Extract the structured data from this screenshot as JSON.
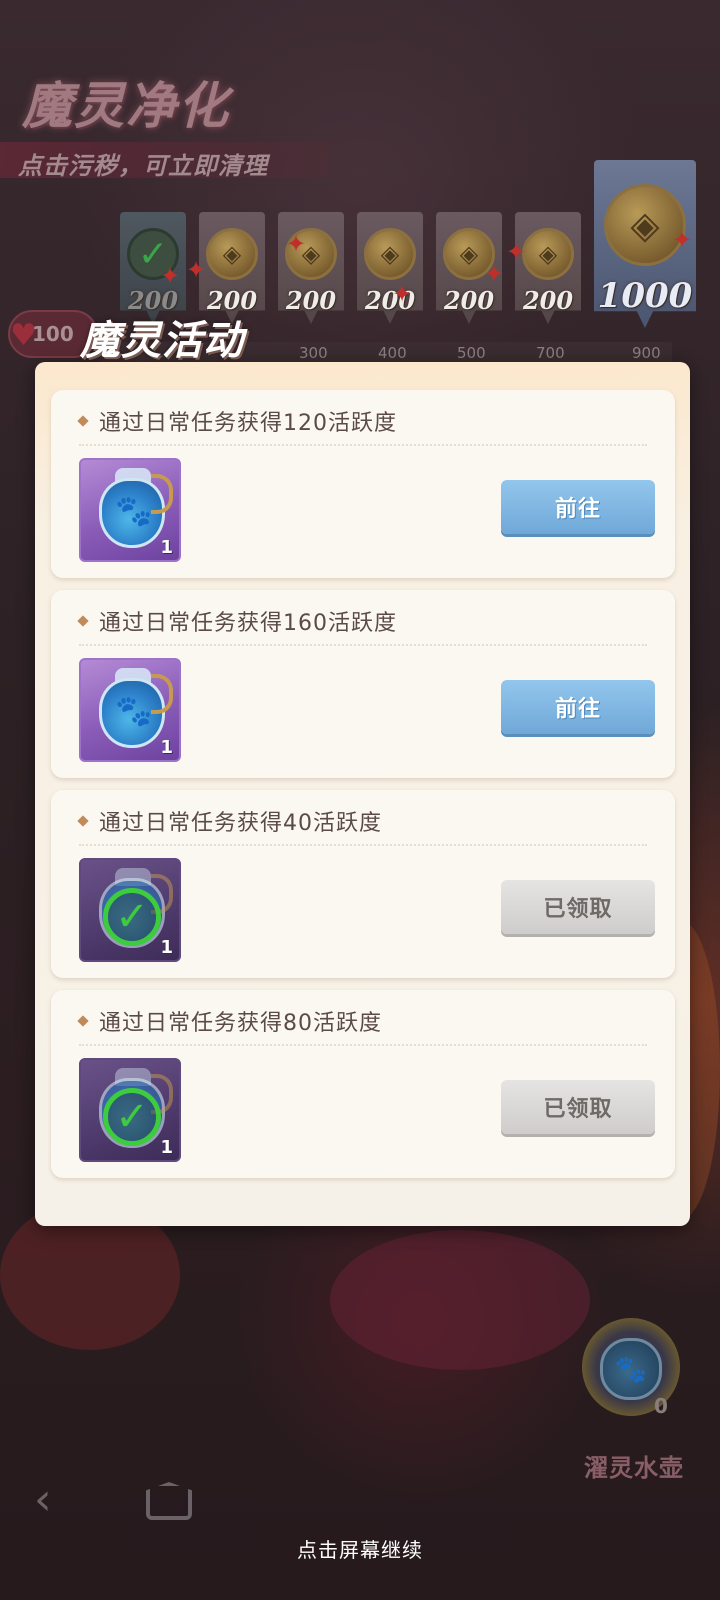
{
  "header": {
    "title": "魔灵净化",
    "subtitle": "点击污秽，可立即清理"
  },
  "reward_track": {
    "current_score": "100",
    "rewards": [
      {
        "amount": "200",
        "claimed": true
      },
      {
        "amount": "200",
        "claimed": false
      },
      {
        "amount": "200",
        "claimed": false
      },
      {
        "amount": "200",
        "claimed": false
      },
      {
        "amount": "200",
        "claimed": false
      },
      {
        "amount": "200",
        "claimed": false
      },
      {
        "amount": "1000",
        "claimed": false
      }
    ],
    "ticks": [
      "300",
      "400",
      "500",
      "700",
      "900"
    ]
  },
  "popup": {
    "title": "魔灵活动",
    "tasks": [
      {
        "title": "通过日常任务获得120活跃度",
        "item_qty": "1",
        "button": "前往",
        "status": "available"
      },
      {
        "title": "通过日常任务获得160活跃度",
        "item_qty": "1",
        "button": "前往",
        "status": "available"
      },
      {
        "title": "通过日常任务获得40活跃度",
        "item_qty": "1",
        "button": "已领取",
        "status": "claimed"
      },
      {
        "title": "通过日常任务获得80活跃度",
        "item_qty": "1",
        "button": "已领取",
        "status": "claimed"
      }
    ]
  },
  "hud": {
    "kettle_count": "0",
    "kettle_label": "濯灵水壶",
    "continue_hint": "点击屏幕继续",
    "icons": {
      "back": "back-arrow-icon",
      "home": "home-icon",
      "kettle": "water-kettle-icon"
    }
  },
  "colors": {
    "go_button": "#7fb4e2",
    "claimed_button": "#d9d7d5",
    "item_frame": "#8a5cb8",
    "check": "#3dcc3d"
  }
}
